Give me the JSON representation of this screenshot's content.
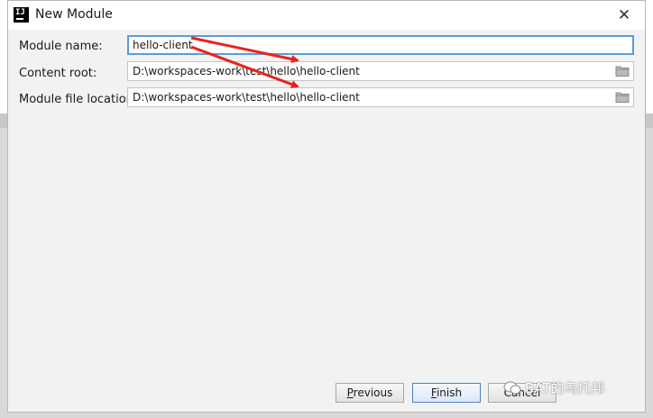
{
  "dialog": {
    "title": "New Module",
    "app_logo_text": "IJ"
  },
  "form": {
    "module_name": {
      "label": "Module name:",
      "value": "hello-client"
    },
    "content_root": {
      "label": "Content root:",
      "value": "D:\\workspaces-work\\test\\hello\\hello-client"
    },
    "module_file_location": {
      "label": "Module file location:",
      "value": "D:\\workspaces-work\\test\\hello\\hello-client"
    }
  },
  "buttons": {
    "previous": {
      "label_mn": "P",
      "label_rest": "revious"
    },
    "finish": {
      "label_mn": "F",
      "label_rest": "inish"
    },
    "cancel": {
      "label": "Cancel"
    }
  },
  "watermark": {
    "text": "BAT的乌托邦"
  },
  "colors": {
    "focus_border": "#5e9ad6",
    "annotation_arrow": "#e8231c",
    "default_button_border": "#4b80c5"
  },
  "icons": [
    "app-logo-icon",
    "close-icon",
    "folder-icon",
    "wechat-icon"
  ]
}
